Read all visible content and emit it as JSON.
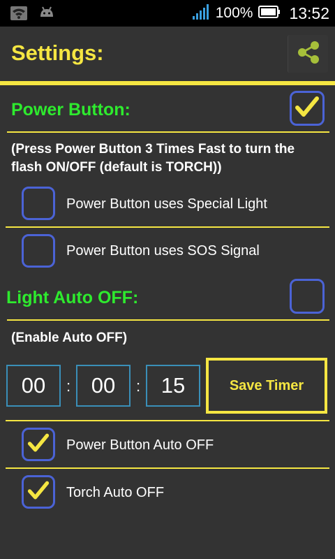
{
  "status_bar": {
    "battery_percent": "100%",
    "time": "13:52",
    "icons": [
      "wifi-icon",
      "android-icon",
      "signal-icon",
      "battery-icon"
    ]
  },
  "action_bar": {
    "title": "Settings:",
    "share_icon": "share-icon"
  },
  "power_button": {
    "heading": "Power Button:",
    "checked": true,
    "description": "(Press Power Button 3 Times Fast to turn the flash ON/OFF (default is TORCH))",
    "options": [
      {
        "label": "Power Button uses Special Light",
        "checked": false
      },
      {
        "label": "Power Button uses SOS Signal",
        "checked": false
      }
    ]
  },
  "light_auto_off": {
    "heading": "Light Auto OFF:",
    "checked": false,
    "description": "(Enable Auto OFF)",
    "timer": {
      "hours": "00",
      "minutes": "00",
      "seconds": "15",
      "separator": ":"
    },
    "save_label": "Save Timer",
    "options": [
      {
        "label": "Power Button Auto OFF",
        "checked": true
      },
      {
        "label": "Torch Auto OFF",
        "checked": true
      }
    ]
  },
  "colors": {
    "background": "#333333",
    "accent_yellow": "#f5e642",
    "heading_green": "#2eea2e",
    "checkbox_border": "#4b63d6",
    "timer_border": "#3a8fb8"
  }
}
